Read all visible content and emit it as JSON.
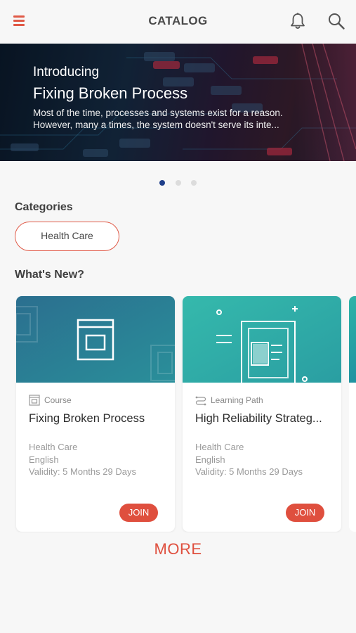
{
  "header": {
    "title": "CATALOG",
    "menu_icon": "hamburger-menu-icon",
    "notification_icon": "bell-icon",
    "search_icon": "search-icon",
    "accent_color": "#e05a47"
  },
  "banner": {
    "eyebrow": "Introducing",
    "title": "Fixing Broken Process",
    "description_line1": "Most of the time, processes and systems exist for a reason.",
    "description_line2": "However, many a times, the system doesn't serve its inte...",
    "slides_total": 3,
    "active_slide": 1
  },
  "categories": {
    "heading": "Categories",
    "items": [
      {
        "label": "Health Care"
      }
    ]
  },
  "whats_new": {
    "heading": "What's New?",
    "cards": [
      {
        "type": "Course",
        "type_icon": "course-icon",
        "title": "Fixing Broken Process",
        "category": "Health Care",
        "language": "English",
        "validity": "Validity: 5 Months 29 Days",
        "action": "JOIN"
      },
      {
        "type": "Learning Path",
        "type_icon": "learning-path-icon",
        "title": "High Reliability Strateg...",
        "category": "Health Care",
        "language": "English",
        "validity": "Validity: 5 Months 29 Days",
        "action": "JOIN"
      }
    ]
  },
  "more_label": "MORE",
  "colors": {
    "accent": "#df4f3e",
    "active_dot": "#1f3f8a",
    "card1_header": "#2a7d92",
    "card2_header": "#2fb1a6"
  }
}
